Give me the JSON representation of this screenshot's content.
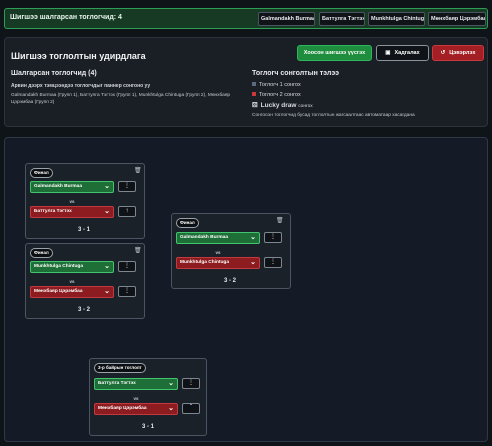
{
  "topbar": {
    "winners": "Шигшээ шалгарсан тоглогчид: 4",
    "chips": [
      "Galmandakh Burmaa",
      "Баттулга Тэгтэх",
      "Munkhtulga Chintuga",
      "Мөнхбаяр Цэрэмбаа"
    ]
  },
  "panel": {
    "title": "Шигшээ тоглолтын удирдлага",
    "start_button": "Хоосон шигшээ үүсгэх",
    "save_button": "Хадгалах",
    "reset_button": "Цэвэрлэх",
    "left_heading": "Шалгарсан тоглогчид (4)",
    "left_sub": "Арвин дээрх тэмцээндээ тоглогчдыг паннер сонгоно уу",
    "left_list": "Galmandakh Burmaa (Групп 1), Баттулга Тэгтэх (Групп 1), Munkhtulga Chintuga (Групп 2), Мөнхбаяр Цэрэмбаа (Групп 2)",
    "right_heading": "Тоглогч сонголтын тэлээ",
    "legend": [
      {
        "label": "Тоглогч 1 сонгох",
        "color": "#5b6b7c"
      },
      {
        "label": "Тоглогч 2 сонгох",
        "color": "#c8393e"
      }
    ],
    "lucky": "Lucky draw",
    "lucky_suffix": "сонгох",
    "note": "Сонгосон тоглогчид бусад тоглолтын жагсаалтаас автоматаар хасагдана"
  },
  "matches": [
    {
      "tag": "Финал",
      "player1": "Galmandakh Burmaa",
      "player2": "Баттулга Тэгтэх",
      "vs": "vs",
      "score": "3 - 1",
      "btn1": "⋮",
      "btn2": "↑"
    },
    {
      "tag": "Финал",
      "player1": "Munkhtulga Chintuga",
      "player2": "Мөнхбаяр Цэрэмбаа",
      "vs": "vs",
      "score": "3 - 2",
      "btn1": "⋮",
      "btn2": "⋮"
    },
    {
      "tag": "Финал",
      "player1": "Galmandakh Burmaa",
      "player2": "Munkhtulga Chintuga",
      "vs": "vs",
      "score": "3 - 2",
      "btn1": "⋮",
      "btn2": "⋮"
    },
    {
      "tag": "3-р байрын тоглолт",
      "player1": "Баттулга Тэгтэх",
      "player2": "Мөнхбаяр Цэрэмбаа",
      "vs": "vs",
      "score": "3 - 1",
      "btn1": "⋮",
      "btn2": "ˇ"
    }
  ],
  "icons": {
    "trash": "trash-icon",
    "save": "floppy-disk-icon",
    "reset": "rotate-left-icon",
    "chevron": "chevron-down-icon"
  },
  "colors": {
    "win": "#1e6e37",
    "lose": "#8c1c20",
    "accent": "#1e8e3e",
    "danger": "#a31f24"
  }
}
